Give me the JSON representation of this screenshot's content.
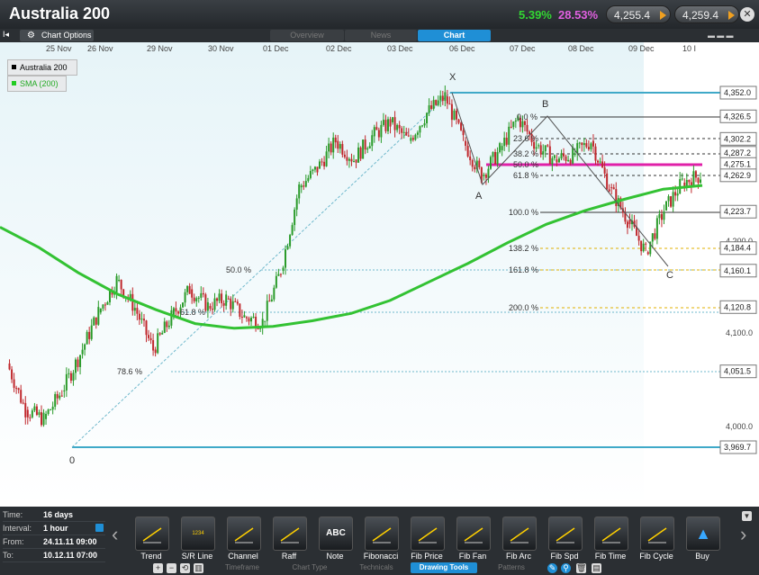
{
  "header": {
    "title": "Australia 200",
    "change_pct": "5.39%",
    "change_pct2": "28.53%",
    "sell_price": "4,255.4",
    "buy_price": "4,259.4",
    "close_label": "✕"
  },
  "tabbar": {
    "collapse_label": "I◂",
    "chart_options_label": "Chart Options",
    "tabs": [
      "Overview",
      "News",
      "Chart"
    ]
  },
  "legend": {
    "items": [
      {
        "label": "Australia 200",
        "color": "#000000"
      },
      {
        "label": "SMA (200)",
        "color": "#22cc22"
      }
    ]
  },
  "colors": {
    "up": "#2a9b2a",
    "down": "#c0282d",
    "sma": "#33c233",
    "fib_line": "#3fa9c8",
    "magenta": "#e020a8",
    "fib_gold": "#e0b000"
  },
  "chart_data": {
    "type": "candlestick",
    "x_ticks": [
      "25 Nov",
      "26 Nov",
      "29 Nov",
      "30 Nov",
      "01 Dec",
      "02 Dec",
      "03 Dec",
      "06 Dec",
      "07 Dec",
      "08 Dec",
      "09 Dec",
      "10 I"
    ],
    "price_tags": [
      "4,352.0",
      "4,326.5",
      "4,302.2",
      "4,287.2",
      "4,275.1",
      "4,262.9",
      "4,223.7",
      "4,184.4",
      "4,160.1",
      "4,120.8",
      "4,051.5",
      "3,969.7"
    ],
    "axis_ticks": [
      "4,200.0",
      "4,100.0",
      "4,000.0"
    ],
    "fib_retracement_labels": [
      "50.0 %",
      "61.8 %",
      "78.6 %"
    ],
    "fib_extension_labels": [
      "0.0 %",
      "23.6 %",
      "38.2 %",
      "50.0 %",
      "61.8 %",
      "100.0 %",
      "138.2 %",
      "161.8 %",
      "200.0 %"
    ],
    "pattern_points": [
      "X",
      "A",
      "B",
      "C",
      "0"
    ],
    "ylim": [
      3950,
      4380
    ],
    "sma_200": [
      4207,
      4185,
      4158,
      4135,
      4118,
      4103,
      4098,
      4100,
      4106,
      4114,
      4128,
      4148,
      4168,
      4190,
      4210,
      4225,
      4237,
      4248,
      4252
    ],
    "close_series": [
      4060,
      4010,
      4000,
      4030,
      4070,
      4115,
      4150,
      4120,
      4075,
      4110,
      4140,
      4122,
      4130,
      4110,
      4105,
      4160,
      4250,
      4270,
      4300,
      4280,
      4305,
      4320,
      4300,
      4330,
      4348,
      4300,
      4262,
      4290,
      4325,
      4295,
      4280,
      4285,
      4300,
      4250,
      4215,
      4180,
      4225,
      4255,
      4263
    ]
  },
  "info_panel": {
    "rows": [
      {
        "label": "Time:",
        "value": "16 days"
      },
      {
        "label": "Interval:",
        "value": "1 hour"
      },
      {
        "label": "From:",
        "value": "24.11.11 09:00"
      },
      {
        "label": "To:",
        "value": "10.12.11 07:00"
      }
    ]
  },
  "toolbar": {
    "tools": [
      "Trend",
      "S/R Line",
      "Channel",
      "Raff",
      "Note",
      "Fibonacci",
      "Fib Price",
      "Fib Fan",
      "Fib Arc",
      "Fib Spd",
      "Fib Time",
      "Fib Cycle",
      "Buy"
    ],
    "tool_icons": [
      "trend-icon",
      "sr-line-icon",
      "channel-icon",
      "raff-icon",
      "note-icon",
      "fibonacci-icon",
      "fib-price-icon",
      "fib-fan-icon",
      "fib-arc-icon",
      "fib-speed-icon",
      "fib-time-icon",
      "fib-cycle-icon",
      "buy-icon"
    ],
    "note_icon_text": "ABC",
    "sr_icon_text": "1234",
    "tabs": [
      "Timeframe",
      "Chart Type",
      "Technicals",
      "Drawing Tools",
      "Patterns"
    ],
    "active_tab": "Drawing Tools",
    "scroll_left": "‹",
    "scroll_right": "›"
  }
}
